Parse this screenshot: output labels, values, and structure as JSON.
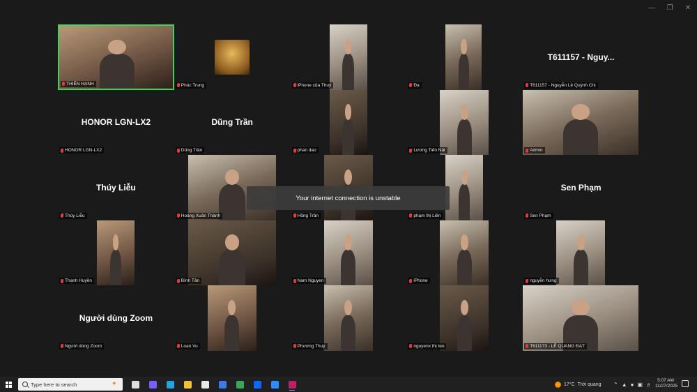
{
  "participants": [
    {
      "name": "THIỆN HẠNH",
      "display": "",
      "active": true,
      "video": "v4"
    },
    {
      "name": "Phúc Trung",
      "display": "",
      "avatar": "buddha"
    },
    {
      "name": "iPhone của Thuý",
      "display": "",
      "video": "v2",
      "vx": [
        56,
        110
      ]
    },
    {
      "name": "Đa",
      "display": "",
      "video": "v1",
      "vx": [
        56,
        108
      ]
    },
    {
      "name": "T611157 - Nguyễn Lê Quỳnh Chi",
      "display": "T611157 - Nguy..."
    },
    {
      "name": "HONOR LGN-LX2",
      "display": "HONOR LGN-LX2"
    },
    {
      "name": "Dũng Trần",
      "display": "Dũng Trần"
    },
    {
      "name": "phan dao",
      "display": "",
      "video": "v3",
      "vx": [
        56,
        110
      ]
    },
    {
      "name": "Lương Tiến Nải",
      "display": "",
      "video": "v2",
      "vx": [
        48,
        118
      ]
    },
    {
      "name": "Admin",
      "display": "",
      "video": "v1",
      "vx": [
        0,
        166
      ]
    },
    {
      "name": "Thúy Liễu",
      "display": "Thúy Liễu"
    },
    {
      "name": "Hoàng Xuân Thành",
      "display": "",
      "video": "v1",
      "vx": [
        20,
        146
      ]
    },
    {
      "name": "Hồng Trần",
      "display": "",
      "video": "v3",
      "vx": [
        48,
        118
      ]
    },
    {
      "name": "phạm thị Liên",
      "display": "",
      "video": "v2",
      "vx": [
        56,
        110
      ]
    },
    {
      "name": "Sen Phạm",
      "display": "Sen Phạm"
    },
    {
      "name": "Thanh Huyền",
      "display": "",
      "video": "v4",
      "vx": [
        56,
        110
      ]
    },
    {
      "name": "Bình Tân",
      "display": "",
      "video": "v3",
      "vx": [
        20,
        146
      ]
    },
    {
      "name": "Nam Nguyen",
      "display": "",
      "video": "v2",
      "vx": [
        48,
        118
      ]
    },
    {
      "name": "iPhone",
      "display": "",
      "video": "v1",
      "vx": [
        48,
        118
      ]
    },
    {
      "name": "nguyễn hưng",
      "display": "",
      "video": "v2",
      "vx": [
        48,
        118
      ]
    },
    {
      "name": "Người dùng Zoom",
      "display": "Người dùng Zoom"
    },
    {
      "name": "Loan Vu",
      "display": "",
      "video": "v4",
      "vx": [
        48,
        118
      ]
    },
    {
      "name": "Phương Thuý",
      "display": "",
      "video": "v1",
      "vx": [
        48,
        118
      ]
    },
    {
      "name": "nguyenx thị teo",
      "display": "",
      "video": "v3",
      "vx": [
        48,
        118
      ]
    },
    {
      "name": "T611173 - LÊ QUANG ĐẠT",
      "display": "",
      "video": "v2",
      "vx": [
        0,
        166
      ]
    }
  ],
  "toast": "Your internet connection is unstable",
  "taskbar": {
    "search_placeholder": "Type here to search",
    "weather_temp": "17°C",
    "weather_desc": "Trời quang",
    "time": "5:07 AM",
    "date": "11/27/2025",
    "apps": [
      {
        "icon": "task-view-icon",
        "color": "#dddddd"
      },
      {
        "icon": "copilot-icon",
        "color": "#7a5cff"
      },
      {
        "icon": "edge-icon",
        "color": "#1fa5e0"
      },
      {
        "icon": "file-explorer-icon",
        "color": "#f2c035"
      },
      {
        "icon": "calendar-icon",
        "color": "#e8e8e8"
      },
      {
        "icon": "mail-icon",
        "color": "#3a7be8"
      },
      {
        "icon": "chrome-icon",
        "color": "#3aa757"
      },
      {
        "icon": "zalo-icon",
        "color": "#0a68ff"
      },
      {
        "icon": "zoom-icon",
        "color": "#2d8cff"
      },
      {
        "icon": "obs-icon",
        "color": "#c02060",
        "running": true
      }
    ]
  }
}
